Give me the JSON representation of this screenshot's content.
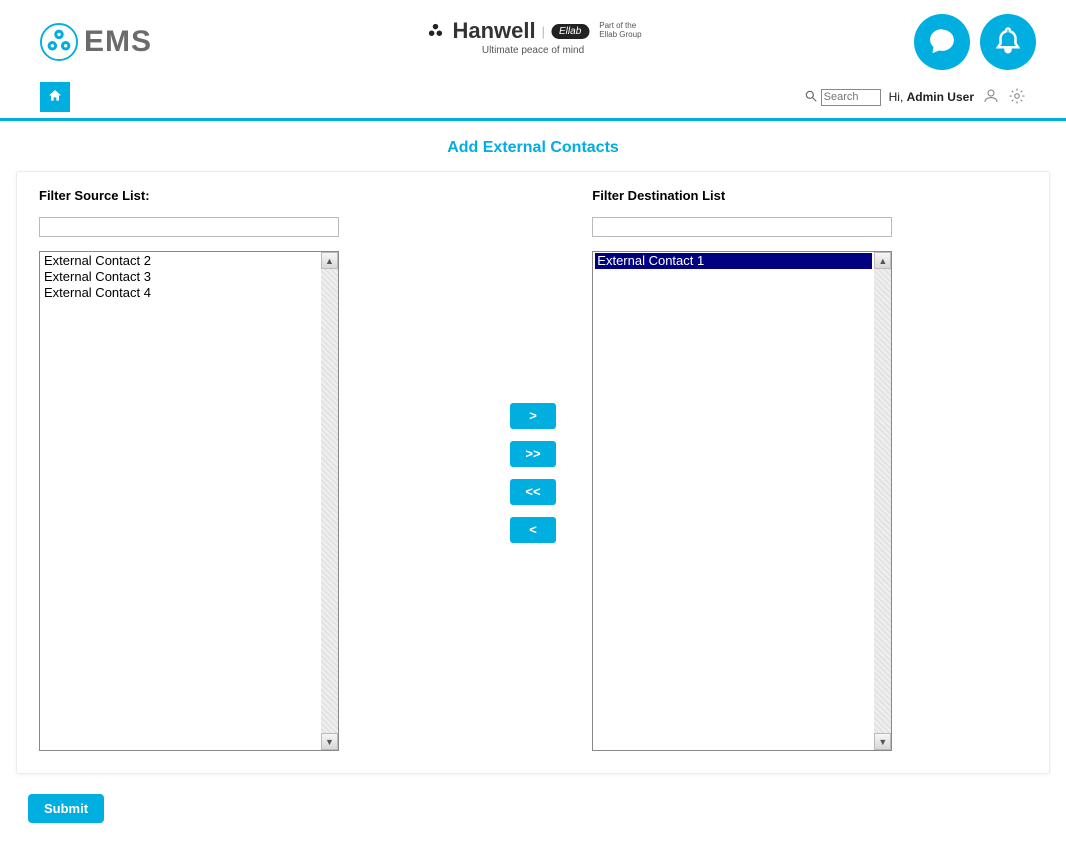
{
  "brand": {
    "ems_text": "EMS",
    "hanwell_text": "Hanwell",
    "hanwell_badge": "Ellab",
    "hanwell_tagline": "Ultimate peace of mind",
    "hanwell_sub1": "Part of the",
    "hanwell_sub2": "Ellab Group"
  },
  "toolbar": {
    "search_placeholder": "Search",
    "greeting_prefix": "Hi,",
    "username": "Admin User"
  },
  "page": {
    "title": "Add External Contacts"
  },
  "source": {
    "label": "Filter Source List:",
    "filter_value": "",
    "items": [
      "External Contact 2",
      "External Contact 3",
      "External Contact 4"
    ]
  },
  "destination": {
    "label": "Filter Destination List",
    "filter_value": "",
    "items": [
      "External Contact 1"
    ],
    "selected_index": 0
  },
  "transfer": {
    "add": ">",
    "add_all": ">>",
    "remove_all": "<<",
    "remove": "<"
  },
  "actions": {
    "submit": "Submit"
  },
  "colors": {
    "accent": "#00aee0"
  }
}
